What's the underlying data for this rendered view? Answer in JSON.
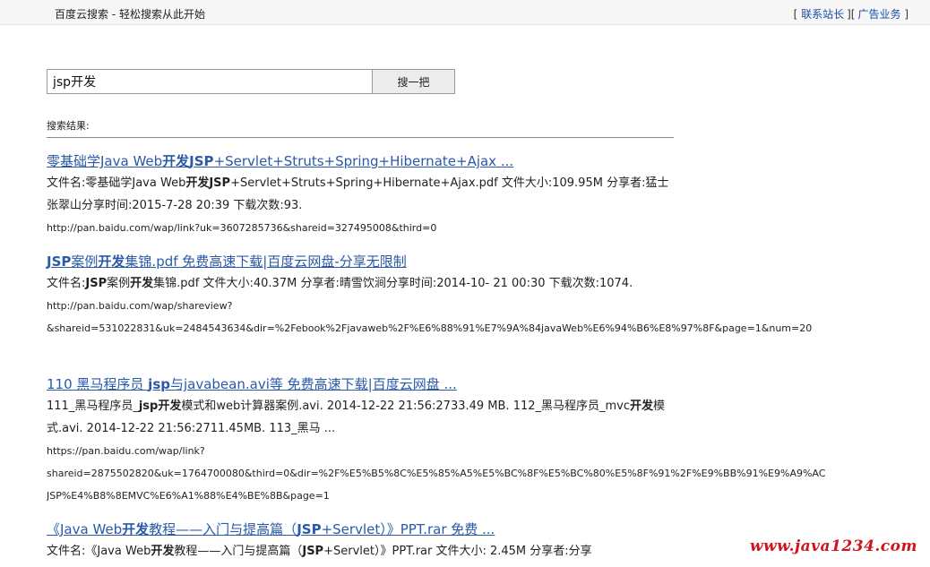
{
  "header": {
    "site_title": "百度云搜索 - 轻松搜索从此开始",
    "links": [
      {
        "label": "联系站长"
      },
      {
        "label": "广告业务"
      }
    ],
    "open_bracket": "[",
    "mid_bracket": "][",
    "close_bracket": "]"
  },
  "search": {
    "query": "jsp开发",
    "button_label": "搜一把"
  },
  "results_label": "搜索结果:",
  "results": [
    {
      "title_parts": [
        "零基础学Java Web",
        "开发",
        "JSP",
        "+Servlet+Struts+Spring+Hibernate+Ajax ..."
      ],
      "desc_html": "文件名:零基础学Java Web<b>开发</b><b>JSP</b>+Servlet+Struts+Spring+Hibernate+Ajax.pdf 文件大小:109.95M 分享者:猛士张翠山分享时间:2015-7-28 20:39 下载次数:93.",
      "url_lines": [
        "http://pan.baidu.com/wap/link?uk=3607285736&shareid=327495008&third=0"
      ]
    },
    {
      "title_parts": [
        "",
        "",
        "JSP",
        "案例",
        "开发",
        "集锦.pdf  免费高速下载|百度云网盘-分享无限制"
      ],
      "desc_html": "文件名:<b>JSP</b>案例<b>开发</b>集锦.pdf 文件大小:40.37M 分享者:晴雪饮涧分享时间:2014-10- 21 00:30 下载次数:1074.",
      "url_lines": [
        "http://pan.baidu.com/wap/shareview?",
        "&shareid=531022831&uk=2484543634&dir=%2Febook%2Fjavaweb%2F%E6%88%91%E7%9A%84javaWeb%E6%94%B6%E8%97%8F&page=1&num=20"
      ]
    },
    {
      "title_parts": [
        "110  黑马程序员  ",
        "jsp",
        "与javabean.avi等  免费高速下载|百度云网盘 ..."
      ],
      "desc_html": "111_黑马程序员_<b>jsp开发</b>模式和web计算器案例.avi. 2014-12-22 21:56:2733.49 MB. 112_黑马程序员_mvc<b>开发</b>模式.avi. 2014-12-22 21:56:2711.45MB. 113_黑马  ...",
      "url_lines": [
        "https://pan.baidu.com/wap/link?",
        "shareid=2875502820&uk=1764700080&third=0&dir=%2F%E5%B5%8C%E5%85%A5%E5%BC%8F%E5%BC%80%E5%8F%91%2F%E9%BB%91%E9%A9%AC",
        "JSP%E4%B8%8EMVC%E6%A1%88%E4%BE%8B&page=1"
      ]
    },
    {
      "title_parts": [
        "《Java Web",
        "开发",
        "教程——入门与提高篇（",
        "JSP",
        "+Servlet）》PPT.rar  免费 ..."
      ],
      "desc_html": "文件名:《Java Web<b>开发</b>教程——入门与提高篇（<b>JSP</b>+Servlet）》PPT.rar 文件大小: 2.45M 分享者:分享",
      "url_lines": []
    }
  ],
  "watermark": "www.java1234.com",
  "colors": {
    "link": "#2a59a8",
    "watermark": "#d0141b",
    "topbar_bg": "#f7f7f7"
  }
}
